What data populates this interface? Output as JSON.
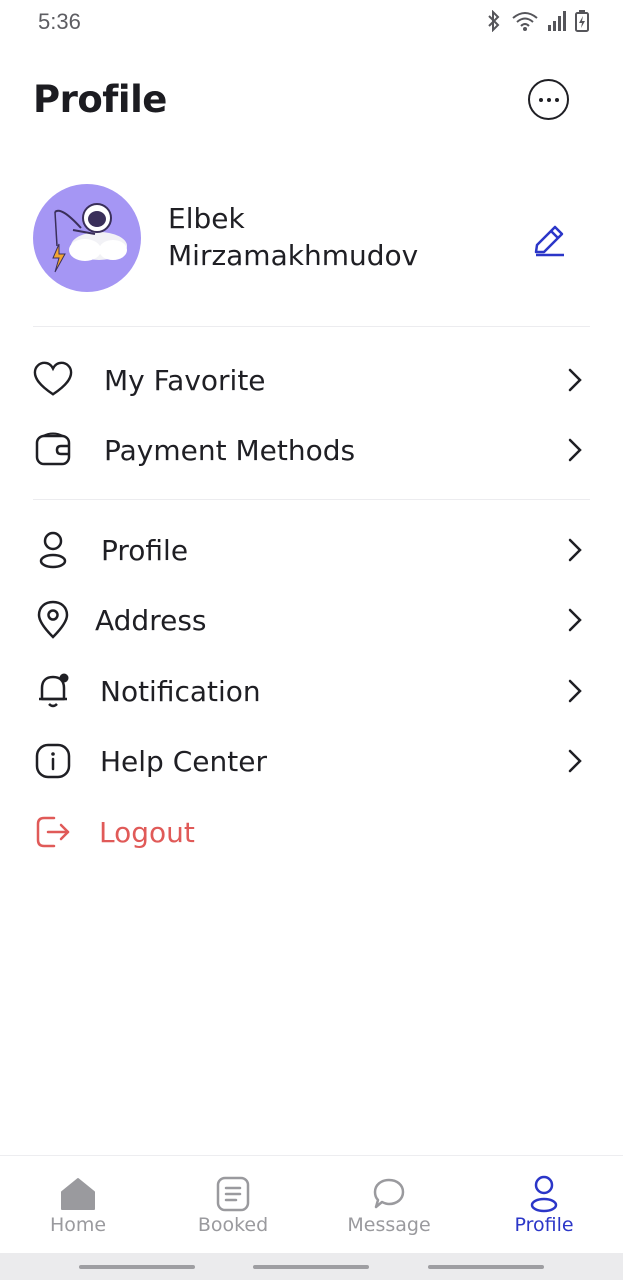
{
  "status_bar": {
    "time": "5:36"
  },
  "header": {
    "title": "Profile"
  },
  "user": {
    "name": "Elbek Mirzamakhmudov"
  },
  "menu_group_1": [
    {
      "label": "My Favorite",
      "icon": "heart-icon"
    },
    {
      "label": "Payment Methods",
      "icon": "wallet-icon"
    }
  ],
  "menu_group_2": [
    {
      "label": "Profile",
      "icon": "user-icon"
    },
    {
      "label": "Address",
      "icon": "location-pin-icon"
    },
    {
      "label": "Notification",
      "icon": "bell-icon"
    },
    {
      "label": "Help Center",
      "icon": "info-icon"
    }
  ],
  "logout": {
    "label": "Logout",
    "icon": "logout-icon"
  },
  "bottom_nav": [
    {
      "label": "Home",
      "icon": "home-icon"
    },
    {
      "label": "Booked",
      "icon": "booked-icon"
    },
    {
      "label": "Message",
      "icon": "chat-icon"
    },
    {
      "label": "Profile",
      "icon": "profile-icon",
      "active": true
    }
  ],
  "colors": {
    "accent": "#2b36c8",
    "logout": "#e05a58",
    "avatar_bg": "#a596f4",
    "text": "#1f1f24",
    "muted": "#9a9a9e"
  }
}
